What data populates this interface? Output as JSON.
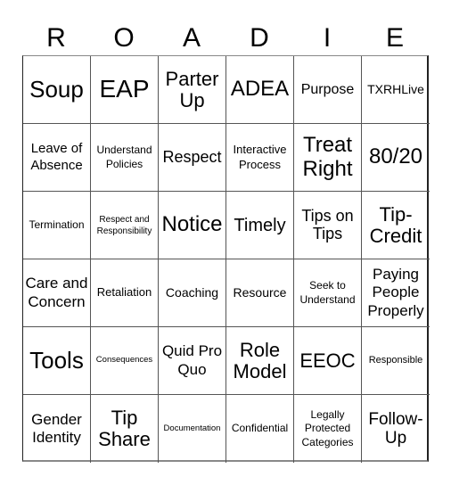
{
  "header": {
    "letters": [
      "R",
      "O",
      "A",
      "D",
      "I",
      "E"
    ]
  },
  "board": {
    "cells": [
      [
        "Soup",
        "EAP",
        "Parter Up",
        "ADEA",
        "Purpose",
        "TXRHLive"
      ],
      [
        "Leave of Absence",
        "Understand Policies",
        "Respect",
        "Interactive Process",
        "Treat Right",
        "80/20"
      ],
      [
        "Termination",
        "Respect and Responsibility",
        "Notice",
        "Timely",
        "Tips on Tips",
        "Tip-Credit"
      ],
      [
        "Care and Concern",
        "Retaliation",
        "Coaching",
        "Resource",
        "Seek to Understand",
        "Paying People Properly"
      ],
      [
        "Tools",
        "Consequences",
        "Quid Pro Quo",
        "Role Model",
        "EEOC",
        "Responsible"
      ],
      [
        "Gender Identity",
        "Tip Share",
        "Documentation",
        "Confidential",
        "Legally Protected Categories",
        "Follow-Up"
      ]
    ]
  }
}
